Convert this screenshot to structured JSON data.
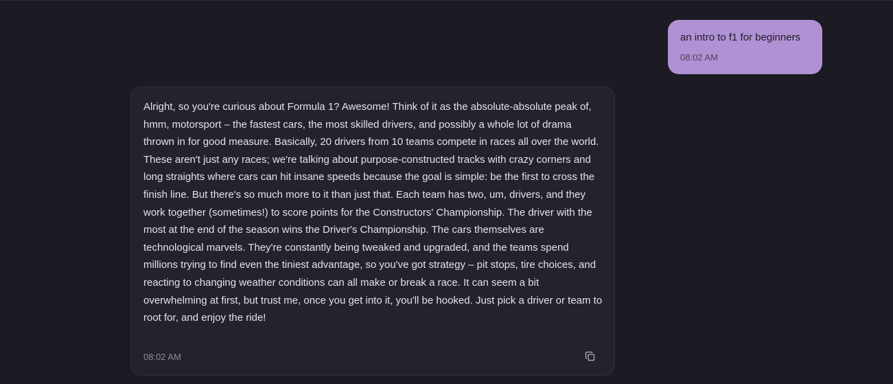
{
  "conversation": {
    "user_message": {
      "text": "an intro to f1 for beginners",
      "time": "08:02 AM"
    },
    "assistant_message": {
      "text": "Alright, so you're curious about Formula 1? Awesome! Think of it as the absolute-absolute peak of, hmm, motorsport – the fastest cars, the most skilled drivers, and possibly a whole lot of drama thrown in for good measure. Basically, 20 drivers from 10 teams compete in races all over the world. These aren't just any races; we're talking about purpose-constructed tracks with crazy corners and long straights where cars can hit insane speeds because the goal is simple: be the first to cross the finish line. But there's so much more to it than just that. Each team has two, um, drivers, and they work together (sometimes!) to score points for the Constructors' Championship. The driver with the most at the end of the season wins the Driver's Championship. The cars themselves are technological marvels. They're constantly being tweaked and upgraded, and the teams spend millions trying to find even the tiniest advantage, so you've got strategy – pit stops, tire choices, and reacting to changing weather conditions can all make or break a race. It can seem a bit overwhelming at first, but trust me, once you get into it, you'll be hooked. Just pick a driver or team to root for, and enjoy the ride!",
      "time": "08:02 AM",
      "copy_icon": "copy-icon"
    }
  },
  "colors": {
    "background": "#1c1a22",
    "user_bubble": "#b092d4",
    "assistant_bubble": "#24222b"
  }
}
